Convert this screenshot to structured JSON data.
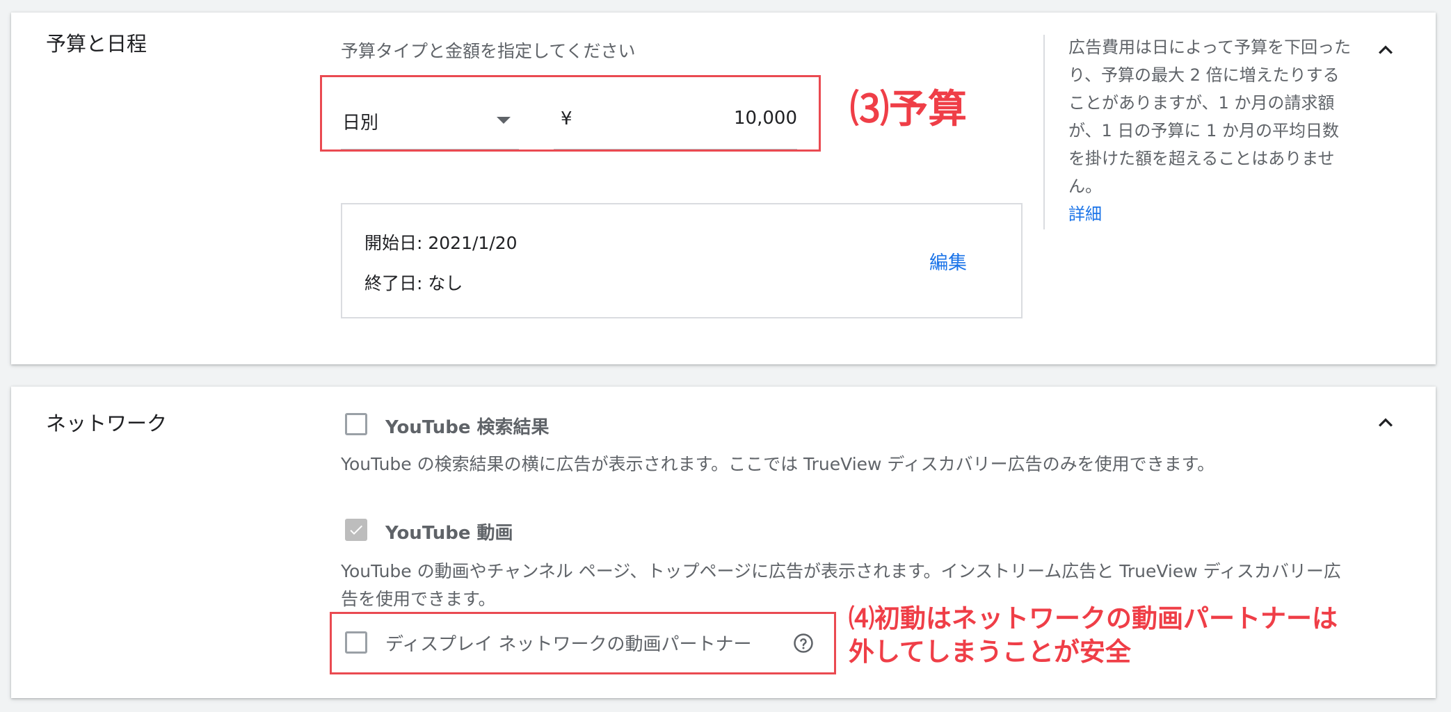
{
  "budget_section": {
    "title": "予算と日程",
    "prompt": "予算タイプと金額を指定してください",
    "budget_type": "日別",
    "currency_symbol": "¥",
    "amount": "10,000",
    "annotation": "⑶予算",
    "start_date_label": "開始日: 2021/1/20",
    "end_date_label": "終了日: なし",
    "edit_link": "編集",
    "help_text": "広告費用は日によって予算を下回ったり、予算の最大 2 倍に増えたりすることがありますが、1 か月の請求額が、1 日の予算に 1 か月の平均日数を掛けた額を超えることはありません。",
    "help_link": "詳細"
  },
  "network_section": {
    "title": "ネットワーク",
    "youtube_search": {
      "label": "YouTube 検索結果",
      "checked": false,
      "description": "YouTube の検索結果の横に広告が表示されます。ここでは TrueView ディスカバリー広告のみを使用できます。"
    },
    "youtube_video": {
      "label": "YouTube 動画",
      "checked": true,
      "description": "YouTube の動画やチャンネル ページ、トップページに広告が表示されます。インストリーム広告と TrueView ディスカバリー広告を使用できます。"
    },
    "display_partners": {
      "label": "ディスプレイ ネットワークの動画パートナー",
      "checked": false
    },
    "annotation_line1": "⑷初動はネットワークの動画パートナーは",
    "annotation_line2": "外してしまうことが安全"
  },
  "icons": {
    "collapse": "chevron-up-icon",
    "dropdown": "caret-down-icon",
    "help": "question-circle-icon",
    "check": "check-icon"
  },
  "colors": {
    "page_background": "#f1f3f4",
    "card_background": "#ffffff",
    "annotation_red": "#ea4a51",
    "link_blue": "#1a73e8",
    "secondary_text": "#5f6368",
    "checkbox_checked": "#bdbdbd"
  }
}
